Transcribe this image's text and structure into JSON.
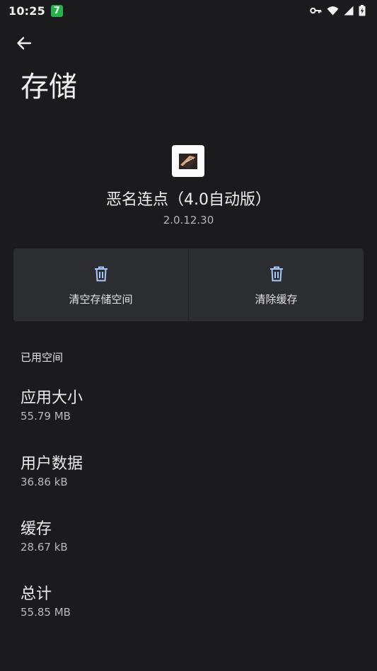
{
  "status_bar": {
    "time": "10:25",
    "badge": "7",
    "icons": [
      "vpn-key-icon",
      "wifi-icon",
      "signal-icon",
      "battery-icon"
    ],
    "badge_color": "#23b34b"
  },
  "toolbar": {
    "back_icon": "arrow-left-icon",
    "title": "存储"
  },
  "app": {
    "name": "恶名连点（4.0自动版）",
    "version": "2.0.12.30"
  },
  "actions": [
    {
      "icon": "trash-icon",
      "label": "清空存储空间"
    },
    {
      "icon": "trash-icon",
      "label": "清除缓存"
    }
  ],
  "storage": {
    "section_title": "已用空间",
    "items": [
      {
        "title": "应用大小",
        "value": "55.79 MB"
      },
      {
        "title": "用户数据",
        "value": "36.86 kB"
      },
      {
        "title": "缓存",
        "value": "28.67 kB"
      },
      {
        "title": "总计",
        "value": "55.85 MB"
      }
    ]
  },
  "colors": {
    "background": "#1b1b1d",
    "button_bg": "#2c2d31",
    "accent_icon": "#a9c7ff"
  }
}
